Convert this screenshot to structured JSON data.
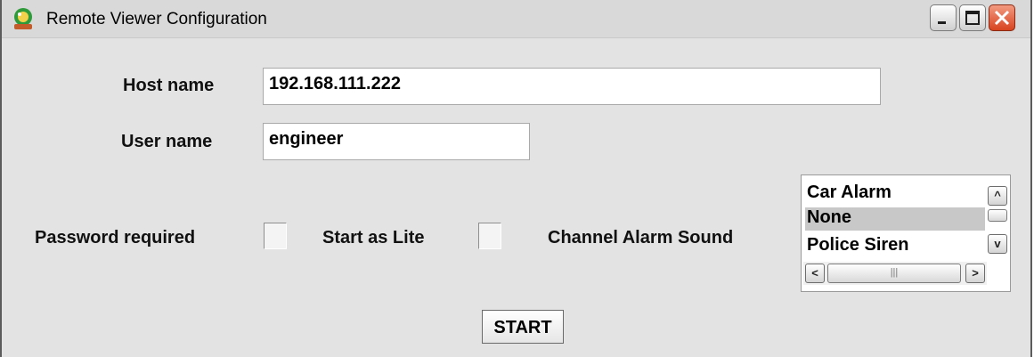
{
  "window": {
    "title": "Remote Viewer Configuration",
    "app_icon": "satellite-dish-icon",
    "controls": [
      "minimize-icon",
      "maximize-icon",
      "close-icon"
    ]
  },
  "form": {
    "host_label": "Host name",
    "host_value": "192.168.111.222",
    "user_label": "User name",
    "user_value": "engineer",
    "password_label": "Password required",
    "password_checked": false,
    "lite_label": "Start as Lite",
    "lite_checked": false,
    "alarm_label": "Channel Alarm Sound",
    "alarm_options": [
      "Car Alarm",
      "None",
      "Police Siren"
    ],
    "alarm_selected": "None",
    "start_label": "START"
  },
  "colors": {
    "window_bg": "#e3e3e3",
    "selection_bg": "#c8c8c8",
    "close_button": "#d8431f"
  }
}
